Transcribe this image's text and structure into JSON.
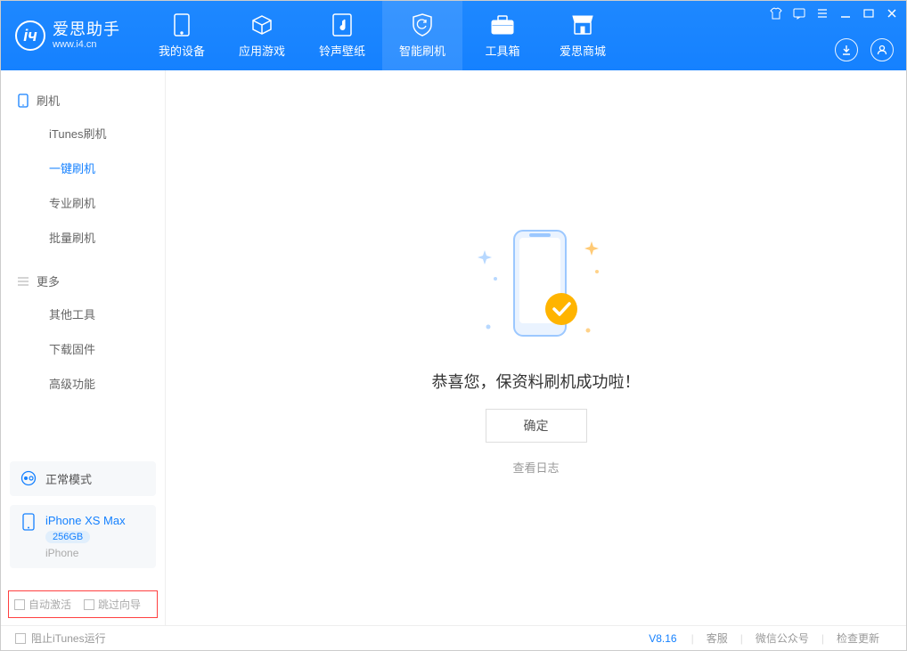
{
  "header": {
    "app_name": "爱思助手",
    "app_url": "www.i4.cn",
    "nav": [
      {
        "label": "我的设备"
      },
      {
        "label": "应用游戏"
      },
      {
        "label": "铃声壁纸"
      },
      {
        "label": "智能刷机"
      },
      {
        "label": "工具箱"
      },
      {
        "label": "爱思商城"
      }
    ]
  },
  "sidebar": {
    "section1_title": "刷机",
    "section1_items": [
      {
        "label": "iTunes刷机"
      },
      {
        "label": "一键刷机"
      },
      {
        "label": "专业刷机"
      },
      {
        "label": "批量刷机"
      }
    ],
    "section2_title": "更多",
    "section2_items": [
      {
        "label": "其他工具"
      },
      {
        "label": "下载固件"
      },
      {
        "label": "高级功能"
      }
    ],
    "mode_label": "正常模式",
    "device": {
      "name": "iPhone XS Max",
      "storage": "256GB",
      "type": "iPhone"
    },
    "checkbox1": "自动激活",
    "checkbox2": "跳过向导"
  },
  "main": {
    "success_text": "恭喜您，保资料刷机成功啦！",
    "ok_button": "确定",
    "view_log": "查看日志"
  },
  "footer": {
    "block_itunes": "阻止iTunes运行",
    "version": "V8.16",
    "link1": "客服",
    "link2": "微信公众号",
    "link3": "检查更新"
  }
}
